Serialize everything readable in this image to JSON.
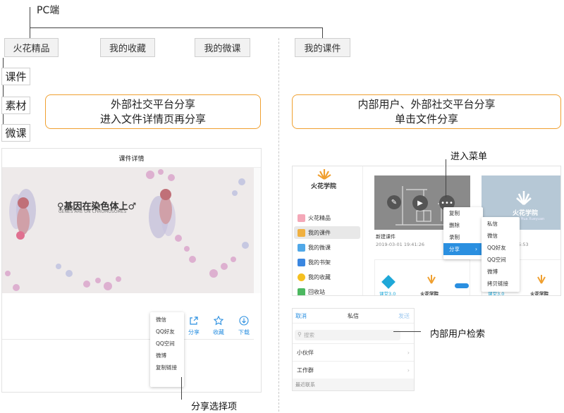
{
  "root_label": "PC端",
  "top_tabs": [
    "火花精品",
    "我的收藏",
    "我的微课",
    "我的课件"
  ],
  "left_items": [
    "课件",
    "素材",
    "微课"
  ],
  "left_note": [
    "外部社交平台分享",
    "进入文件详情页再分享"
  ],
  "right_note": [
    "内部用户、外部社交平台分享",
    "单击文件分享"
  ],
  "left_screen": {
    "title": "课件详情",
    "banner_title": "♀基因在染色体上♂",
    "banner_sub": "GENES ARE ON CHROMOSOMES",
    "share_menu": [
      "微信",
      "QQ好友",
      "QQ空间",
      "微博",
      "复制链接"
    ],
    "actions": [
      "分享",
      "收藏",
      "下载"
    ]
  },
  "right_screen": {
    "logo": "火花学院",
    "sidebar": [
      "火花精品",
      "我的课件",
      "我的微课",
      "我的书架",
      "我的收藏",
      "回收站"
    ],
    "card_name": "新建课件",
    "card_date": "2019-03-01 19:41:26",
    "card_date2": "5:53",
    "context_menu": [
      "复制",
      "删除",
      "录制",
      "分享"
    ],
    "submenu": [
      "私信",
      "微信",
      "QQ好友",
      "QQ空间",
      "微博",
      "拷贝链接"
    ],
    "right_card_logo": "火花学院",
    "right_card_en": "Huo Hua Xueyuan",
    "bottom_card_a": "课堂3.0",
    "bottom_card_b": "火花学院",
    "bottom_card_c": "课堂3.0",
    "bottom_card_d": "火花学院"
  },
  "dm_panel": {
    "cancel": "取消",
    "title": "私信",
    "send": "发送",
    "search_placeholder": "搜索",
    "rows": [
      "小伙伴",
      "工作群"
    ],
    "section": "最近联系"
  },
  "annotations": {
    "enter_menu": "进入菜单",
    "user_search": "内部用户检索",
    "share_options": "分享选择项"
  },
  "colors": {
    "accent_orange": "#f0a030",
    "link_blue": "#2a8fe0",
    "selected_blue": "#2a8fe0"
  }
}
